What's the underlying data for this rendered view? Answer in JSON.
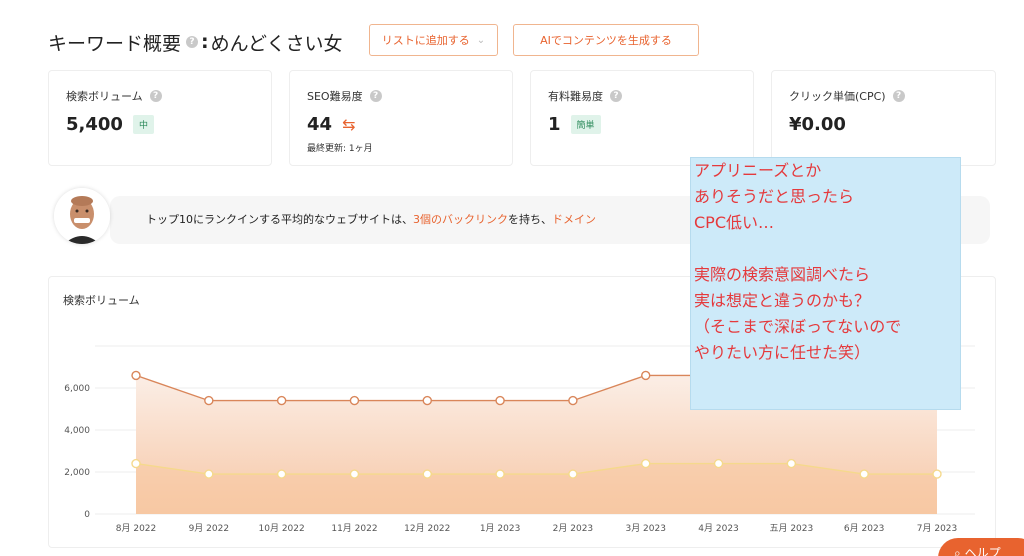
{
  "header": {
    "title": "キーワード概要",
    "keyword_sep": ":",
    "keyword": "めんどくさい女",
    "add_to_list": "リストに追加する",
    "ai_generate": "AIでコンテンツを生成する"
  },
  "cards": [
    {
      "label": "検索ボリューム",
      "value": "5,400",
      "badge": "中"
    },
    {
      "label": "SEO難易度",
      "value": "44",
      "sub": "最終更新: 1ヶ月"
    },
    {
      "label": "有料難易度",
      "value": "1",
      "badge": "簡単"
    },
    {
      "label": "クリック単価(CPC)",
      "value": "¥0.00"
    }
  ],
  "banner": {
    "before": "トップ10にランクインする平均的なウェブサイトは、",
    "highlight": "3個のバックリンク",
    "middle": "を持ち、",
    "highlight2": "ドメイン"
  },
  "note": {
    "lines": [
      "アプリニーズとか",
      "ありそうだと思ったら",
      "CPC低い…",
      "",
      "実際の検索意図調べたら",
      "実は想定と違うのかも？",
      "（そこまで深ぼってないので",
      "やりたい方に任せた笑）"
    ]
  },
  "help_button": "ヘルプ",
  "chart_data": {
    "type": "area",
    "title": "検索ボリューム",
    "categories": [
      "8月 2022",
      "9月 2022",
      "10月 2022",
      "11月 2022",
      "12月 2022",
      "1月 2023",
      "2月 2023",
      "3月 2023",
      "4月 2023",
      "五月 2023",
      "6月 2023",
      "7月 2023"
    ],
    "series": [
      {
        "values": [
          6600,
          5400,
          5400,
          5400,
          5400,
          5400,
          5400,
          6600,
          6600,
          6600,
          5400,
          5400
        ],
        "color": "#d9865a"
      },
      {
        "values": [
          2400,
          1900,
          1900,
          1900,
          1900,
          1900,
          1900,
          2400,
          2400,
          2400,
          1900,
          1900
        ],
        "color": "#f5d98c"
      }
    ],
    "yticks": [
      0,
      2000,
      4000,
      6000
    ],
    "ytick_labels": [
      "0",
      "2,000",
      "4,000",
      "6,000"
    ],
    "ylim": [
      0,
      8000
    ],
    "grid": true
  }
}
